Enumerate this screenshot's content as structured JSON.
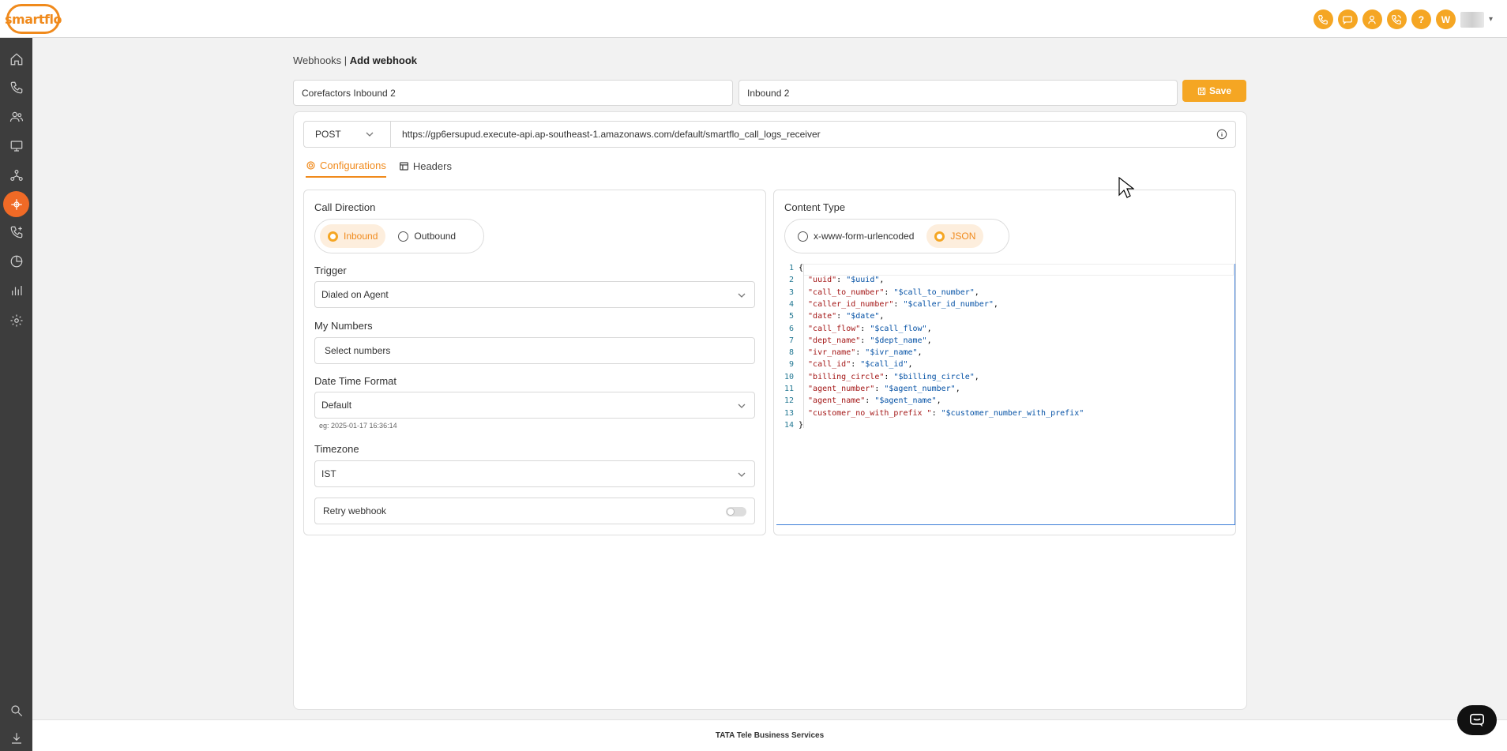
{
  "brand": {
    "logo_text": "smartflo"
  },
  "topbar": {
    "icons": [
      "phone-icon",
      "sms-icon",
      "agent-icon",
      "phone-ring-icon",
      "help-icon",
      "user-initial-icon"
    ],
    "help_label": "?",
    "user_initial": "W"
  },
  "sidebar": {
    "items": [
      "home-icon",
      "phone-icon",
      "users-icon",
      "monitor-icon",
      "network-icon",
      "integrations-icon",
      "ivr-icon",
      "reports-pie-icon",
      "analytics-bar-icon",
      "settings-icon"
    ],
    "active_index": 5,
    "bottom_items": [
      "search-icon",
      "download-icon"
    ]
  },
  "breadcrumb": {
    "parent": "Webhooks",
    "separator": " | ",
    "current": "Add webhook"
  },
  "form": {
    "name_value": "Corefactors Inbound 2",
    "description_value": "Inbound 2",
    "save_label": "Save",
    "method": "POST",
    "url": "https://gp6ersupud.execute-api.ap-southeast-1.amazonaws.com/default/smartflo_call_logs_receiver"
  },
  "tabs": [
    {
      "label": "Configurations",
      "active": true
    },
    {
      "label": "Headers",
      "active": false
    }
  ],
  "config": {
    "call_direction_label": "Call Direction",
    "call_direction_options": [
      "Inbound",
      "Outbound"
    ],
    "call_direction_selected": "Inbound",
    "trigger_label": "Trigger",
    "trigger_value": "Dialed on Agent",
    "my_numbers_label": "My Numbers",
    "my_numbers_placeholder": "Select numbers",
    "date_time_format_label": "Date Time Format",
    "date_time_format_value": "Default",
    "date_time_example": "eg: 2025-01-17 16:36:14",
    "timezone_label": "Timezone",
    "timezone_value": "IST",
    "retry_label": "Retry webhook",
    "retry_enabled": false
  },
  "content_type": {
    "label": "Content Type",
    "options": [
      "x-www-form-urlencoded",
      "JSON"
    ],
    "selected": "JSON"
  },
  "editor": {
    "lines": [
      {
        "n": "1",
        "text": "{"
      },
      {
        "n": "2",
        "key": "\"uuid\"",
        "val": "\"$uuid\"",
        "tail": ","
      },
      {
        "n": "3",
        "key": "\"call_to_number\"",
        "val": "\"$call_to_number\"",
        "tail": ","
      },
      {
        "n": "4",
        "key": "\"caller_id_number\"",
        "val": "\"$caller_id_number\"",
        "tail": ","
      },
      {
        "n": "5",
        "key": "\"date\"",
        "val": "\"$date\"",
        "tail": ","
      },
      {
        "n": "6",
        "key": "\"call_flow\"",
        "val": "\"$call_flow\"",
        "tail": ","
      },
      {
        "n": "7",
        "key": "\"dept_name\"",
        "val": "\"$dept_name\"",
        "tail": ","
      },
      {
        "n": "8",
        "key": "\"ivr_name\"",
        "val": "\"$ivr_name\"",
        "tail": ","
      },
      {
        "n": "9",
        "key": "\"call_id\"",
        "val": "\"$call_id\"",
        "tail": ","
      },
      {
        "n": "10",
        "key": "\"billing_circle\"",
        "val": "\"$billing_circle\"",
        "tail": ","
      },
      {
        "n": "11",
        "key": "\"agent_number\"",
        "val": "\"$agent_number\"",
        "tail": ","
      },
      {
        "n": "12",
        "key": "\"agent_name\"",
        "val": "\"$agent_name\"",
        "tail": ","
      },
      {
        "n": "13",
        "key": "\"customer_no_with_prefix \"",
        "val": "\"$customer_number_with_prefix\"",
        "tail": ""
      },
      {
        "n": "14",
        "text": "}"
      }
    ]
  },
  "footer": {
    "text": "TATA Tele Business Services"
  },
  "colors": {
    "accent": "#f5a623",
    "active_tab": "#f08a1c",
    "sidebar": "#3d3d3d",
    "sidebar_active": "#f06a26"
  }
}
